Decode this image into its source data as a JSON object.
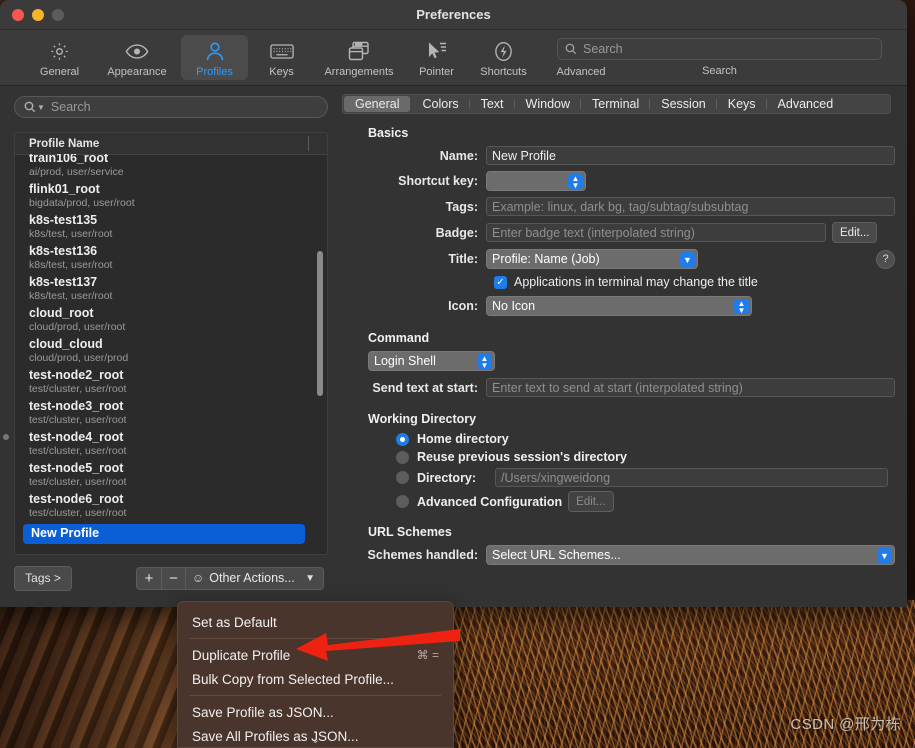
{
  "window": {
    "title": "Preferences",
    "traffic": [
      "close",
      "minimize",
      "zoom"
    ]
  },
  "toolbar": {
    "items": [
      {
        "label": "General",
        "icon": "gear-icon",
        "selected": false
      },
      {
        "label": "Appearance",
        "icon": "eye-icon",
        "selected": false
      },
      {
        "label": "Profiles",
        "icon": "person-icon",
        "selected": true
      },
      {
        "label": "Keys",
        "icon": "keyboard-icon",
        "selected": false
      },
      {
        "label": "Arrangements",
        "icon": "windows-icon",
        "selected": false
      },
      {
        "label": "Pointer",
        "icon": "cursor-icon",
        "selected": false
      },
      {
        "label": "Shortcuts",
        "icon": "bolt-icon",
        "selected": false
      },
      {
        "label": "Advanced",
        "icon": "gears-icon",
        "selected": false
      }
    ],
    "search_placeholder": "Search",
    "search_value": "",
    "search_label": "Search",
    "accent_color": "#2f9bff"
  },
  "sidebar": {
    "search_placeholder": "Search",
    "search_value": "",
    "column_header": "Profile Name",
    "profiles": [
      {
        "name": "train106_root",
        "meta": "ai/prod, user/service",
        "selected": false
      },
      {
        "name": "flink01_root",
        "meta": "bigdata/prod, user/root",
        "selected": false
      },
      {
        "name": "k8s-test135",
        "meta": "k8s/test, user/root",
        "selected": false
      },
      {
        "name": "k8s-test136",
        "meta": "k8s/test, user/root",
        "selected": false
      },
      {
        "name": "k8s-test137",
        "meta": "k8s/test, user/root",
        "selected": false
      },
      {
        "name": "cloud_root",
        "meta": "cloud/prod, user/root",
        "selected": false
      },
      {
        "name": "cloud_cloud",
        "meta": "cloud/prod, user/prod",
        "selected": false
      },
      {
        "name": "test-node2_root",
        "meta": "test/cluster, user/root",
        "selected": false
      },
      {
        "name": "test-node3_root",
        "meta": "test/cluster, user/root",
        "selected": false
      },
      {
        "name": "test-node4_root",
        "meta": "test/cluster, user/root",
        "selected": false
      },
      {
        "name": "test-node5_root",
        "meta": "test/cluster, user/root",
        "selected": false
      },
      {
        "name": "test-node6_root",
        "meta": "test/cluster, user/root",
        "selected": false
      },
      {
        "name": "New Profile",
        "meta": "",
        "selected": true
      }
    ],
    "tags_button": "Tags >",
    "add_button": "+",
    "remove_button": "−",
    "other_actions": "Other Actions...",
    "selection_color": "#0a5fd6"
  },
  "tabs": [
    {
      "label": "General",
      "selected": true
    },
    {
      "label": "Colors",
      "selected": false
    },
    {
      "label": "Text",
      "selected": false
    },
    {
      "label": "Window",
      "selected": false
    },
    {
      "label": "Terminal",
      "selected": false
    },
    {
      "label": "Session",
      "selected": false
    },
    {
      "label": "Keys",
      "selected": false
    },
    {
      "label": "Advanced",
      "selected": false
    }
  ],
  "general": {
    "basics_heading": "Basics",
    "name_label": "Name:",
    "name_value": "New Profile",
    "shortcut_label": "Shortcut key:",
    "shortcut_value": "",
    "tags_label": "Tags:",
    "tags_placeholder": "Example: linux, dark bg, tag/subtag/subsubtag",
    "tags_value": "",
    "badge_label": "Badge:",
    "badge_placeholder": "Enter badge text (interpolated string)",
    "badge_value": "",
    "badge_edit_button": "Edit...",
    "title_label": "Title:",
    "title_value": "Profile: Name (Job)",
    "help_button": "?",
    "apps_change_title_label": "Applications in terminal may change the title",
    "apps_change_title_checked": true,
    "icon_label": "Icon:",
    "icon_value": "No Icon",
    "command_heading": "Command",
    "command_value": "Login Shell",
    "send_text_label": "Send text at start:",
    "send_text_placeholder": "Enter text to send at start (interpolated string)",
    "send_text_value": "",
    "working_directory_heading": "Working Directory",
    "wd_options": [
      {
        "label": "Home directory",
        "selected": true
      },
      {
        "label": "Reuse previous session's directory",
        "selected": false
      },
      {
        "label": "Directory:",
        "selected": false
      },
      {
        "label": "Advanced Configuration",
        "selected": false
      }
    ],
    "directory_placeholder": "/Users/xingweidong",
    "directory_value": "",
    "advanced_edit_button": "Edit...",
    "url_schemes_heading": "URL Schemes",
    "schemes_label": "Schemes handled:",
    "schemes_value": "Select URL Schemes..."
  },
  "context_menu": {
    "items": [
      {
        "label": "Set as Default",
        "shortcut": "",
        "separator_after": true
      },
      {
        "label": "Duplicate Profile",
        "shortcut": "⌘ =",
        "separator_after": false
      },
      {
        "label": "Bulk Copy from Selected Profile...",
        "shortcut": "",
        "separator_after": true
      },
      {
        "label": "Save Profile as JSON...",
        "shortcut": "",
        "separator_after": false
      },
      {
        "label": "Save All Profiles as JSON...",
        "shortcut": "",
        "separator_after": false
      }
    ],
    "more_indicator": "⌄",
    "background_color": "#4a352c"
  },
  "annotation": {
    "arrow_color": "#ee2211",
    "points_at": "Duplicate Profile"
  },
  "watermark": "CSDN @邢为栋"
}
